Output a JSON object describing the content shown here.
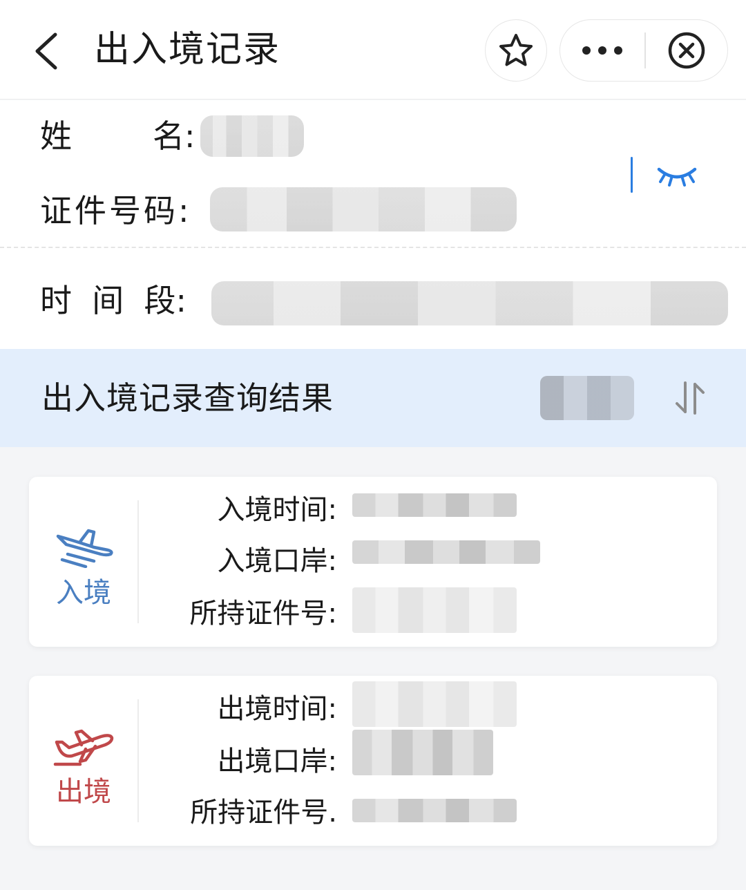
{
  "header": {
    "title": "出入境记录",
    "back_icon": "chevron-left-icon",
    "favorite_icon": "star-icon",
    "more_icon": "more-dots-icon",
    "close_icon": "close-circle-icon"
  },
  "person": {
    "name_label": "姓        名:",
    "id_label": "证件号码:",
    "period_label": "时  间  段:",
    "visibility_icon": "eye-closed-icon"
  },
  "results": {
    "title": "出入境记录查询结果",
    "sort_icon": "sort-arrows-icon"
  },
  "records": [
    {
      "type_label": "入境",
      "icon": "plane-landing-icon",
      "color": "#4a7fc1",
      "fields": [
        {
          "label": "入境时间:"
        },
        {
          "label": "入境口岸:"
        },
        {
          "label": "所持证件号:"
        }
      ]
    },
    {
      "type_label": "出境",
      "icon": "plane-departure-icon",
      "color": "#c0484a",
      "fields": [
        {
          "label": "出境时间:"
        },
        {
          "label": "出境口岸:"
        },
        {
          "label": "所持证件号."
        }
      ]
    }
  ],
  "colors": {
    "accent_blue": "#2a7de1",
    "band_bg": "#e3eefc"
  }
}
